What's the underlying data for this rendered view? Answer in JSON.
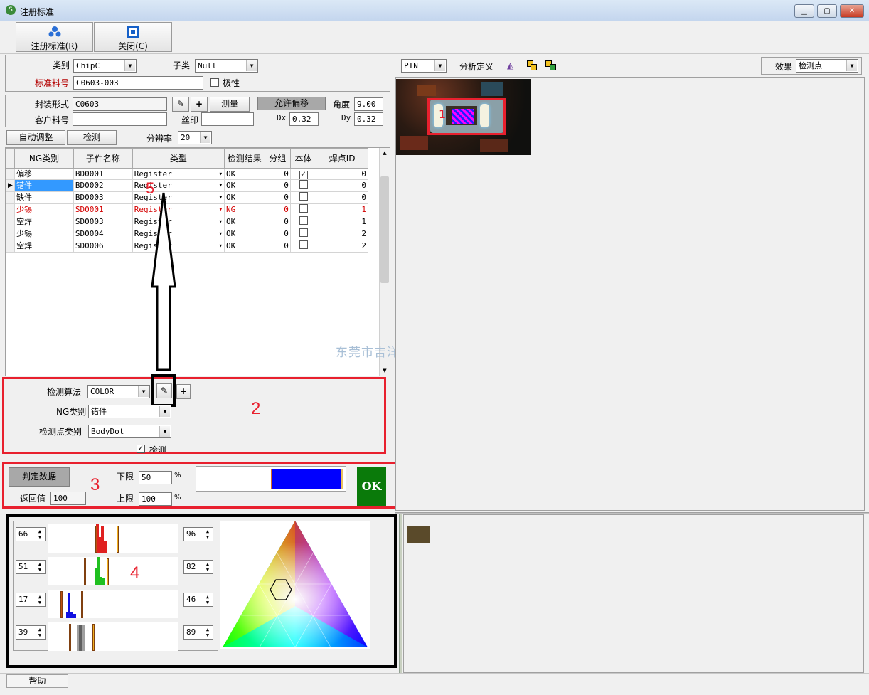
{
  "window": {
    "title": "注册标准",
    "min": "▁",
    "max": "▢",
    "close": "✕"
  },
  "toolbar": {
    "register_label": "注册标准(R)",
    "close_label": "关闭(C)"
  },
  "std": {
    "category_label": "类别",
    "category_value": "ChipC",
    "subcategory_label": "子类",
    "subcategory_value": "Null",
    "partno_label": "标准料号",
    "partno_value": "C0603-003",
    "polarity_label": "极性",
    "package_label": "封装形式",
    "package_value": "C0603",
    "measure_label": "测量",
    "allow_offset_label": "允许偏移",
    "angle_label": "角度",
    "angle_value": "9.00",
    "dx_label": "Dx",
    "dx_value": "0.32",
    "dy_label": "Dy",
    "dy_value": "0.32",
    "customer_label": "客户料号",
    "customer_value": "",
    "silk_label": "丝印",
    "silk_value": "",
    "auto_adjust_label": "自动调整",
    "detect_label": "检测",
    "resolution_label": "分辨率",
    "resolution_value": "20"
  },
  "table": {
    "headers": [
      "NG类别",
      "子件名称",
      "类型",
      "检测结果",
      "分组",
      "本体",
      "焊点ID"
    ],
    "rows": [
      {
        "ng": "偏移",
        "name": "BD0001",
        "type": "Register",
        "result": "OK",
        "group": "0",
        "body": "✓",
        "pad": "0"
      },
      {
        "ng": "错件",
        "name": "BD0002",
        "type": "Register",
        "result": "OK",
        "group": "0",
        "body": "",
        "pad": "0"
      },
      {
        "ng": "缺件",
        "name": "BD0003",
        "type": "Register",
        "result": "OK",
        "group": "0",
        "body": "",
        "pad": "0"
      },
      {
        "ng": "少锡",
        "name": "SD0001",
        "type": "Register",
        "result": "NG",
        "group": "0",
        "body": "",
        "pad": "1"
      },
      {
        "ng": "空焊",
        "name": "SD0003",
        "type": "Register",
        "result": "OK",
        "group": "0",
        "body": "",
        "pad": "1"
      },
      {
        "ng": "少锡",
        "name": "SD0004",
        "type": "Register",
        "result": "OK",
        "group": "0",
        "body": "",
        "pad": "2"
      },
      {
        "ng": "空焊",
        "name": "SD0006",
        "type": "Register",
        "result": "OK",
        "group": "0",
        "body": "",
        "pad": "2"
      }
    ]
  },
  "algo": {
    "algo_label": "检测算法",
    "algo_value": "COLOR",
    "ng_label": "NG类别",
    "ng_value": "错件",
    "point_label": "检测点类别",
    "point_value": "BodyDot",
    "detect_label": "检测"
  },
  "judge": {
    "btn_label": "判定数据",
    "return_label": "返回值",
    "return_value": "100",
    "lower_label": "下限",
    "lower_value": "50",
    "upper_label": "上限",
    "upper_value": "100",
    "pct": "%",
    "level": 100,
    "result": "OK"
  },
  "histo": {
    "rows": [
      {
        "low": "66",
        "high": "96"
      },
      {
        "low": "51",
        "high": "82"
      },
      {
        "low": "17",
        "high": "46"
      },
      {
        "low": "39",
        "high": "89"
      }
    ]
  },
  "right": {
    "pin_value": "PIN",
    "analysis_label": "分析定义",
    "effect_label": "效果",
    "effect_value": "检测点"
  },
  "annotations": {
    "n1": "1",
    "n2": "2",
    "n3": "3",
    "n4": "4",
    "n5": "5"
  },
  "watermark": "东莞市吉洋自动化科技有限公司",
  "status": {
    "help_label": "帮助"
  },
  "colors": {
    "ok_green": "#0a7a0a",
    "annot_red": "#e8202e",
    "level_blue": "#0000ff"
  }
}
